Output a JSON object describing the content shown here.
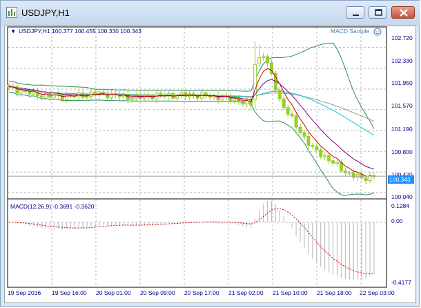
{
  "window": {
    "title": "USDJPY,H1"
  },
  "main_chart": {
    "header": "USDJPY,H1  100.377 100.455 100.330 100.343",
    "expert_label": "MACD Sample",
    "price_labels": [
      "102.720",
      "102.330",
      "101.950",
      "101.570",
      "101.190",
      "100.800",
      "100.420",
      "100.040"
    ],
    "current_price": "100.343"
  },
  "macd_panel": {
    "header": "MACD(12,26,9) -0.3691 -0.3620",
    "scale_labels": [
      "0.1284",
      "0.00",
      "-0.4177"
    ]
  },
  "time_axis": [
    "19 Sep 2016",
    "19 Sep 16:00",
    "20 Sep 01:00",
    "20 Sep 09:00",
    "20 Sep 17:00",
    "21 Sep 02:00",
    "21 Sep 10:00",
    "21 Sep 18:00",
    "22 Sep 03:00"
  ],
  "colors": {
    "candle": "#9acd32",
    "ma_fast": "#cc0000",
    "ma_mid": "#800080",
    "ma_cyan": "#00cccc",
    "ma_grey": "#999999",
    "bands": "#2e8b57",
    "macd_hist": "#c0c0c0",
    "macd_signal": "#cc0000",
    "axis_text": "#00008b"
  },
  "chart_data": {
    "type": "candlestick",
    "ylim": [
      99.95,
      102.93
    ],
    "candle_count": 90,
    "close_anchors": [
      [
        0,
        101.97
      ],
      [
        6,
        101.86
      ],
      [
        10,
        101.82
      ],
      [
        16,
        101.82
      ],
      [
        22,
        101.87
      ],
      [
        30,
        101.79
      ],
      [
        36,
        101.83
      ],
      [
        44,
        101.84
      ],
      [
        52,
        101.8
      ],
      [
        56,
        101.74
      ],
      [
        59,
        101.66
      ],
      [
        60,
        102.42
      ],
      [
        62,
        102.6
      ],
      [
        64,
        102.2
      ],
      [
        66,
        101.75
      ],
      [
        70,
        101.27
      ],
      [
        74,
        100.85
      ],
      [
        78,
        100.65
      ],
      [
        82,
        100.42
      ],
      [
        86,
        100.3
      ],
      [
        89,
        100.343
      ]
    ],
    "series": [
      {
        "name": "Moving Average fast",
        "color": "#cc0000"
      },
      {
        "name": "Moving Average slow",
        "color": "#800080"
      },
      {
        "name": "Moving Average cyan",
        "color": "#00cccc"
      },
      {
        "name": "Moving Average grey",
        "color": "#999999"
      },
      {
        "name": "Bollinger Bands",
        "color": "#2e8b57"
      }
    ],
    "macd": {
      "ylim": [
        -0.46,
        0.155
      ],
      "last_main": -0.3691,
      "last_signal": -0.362
    }
  }
}
